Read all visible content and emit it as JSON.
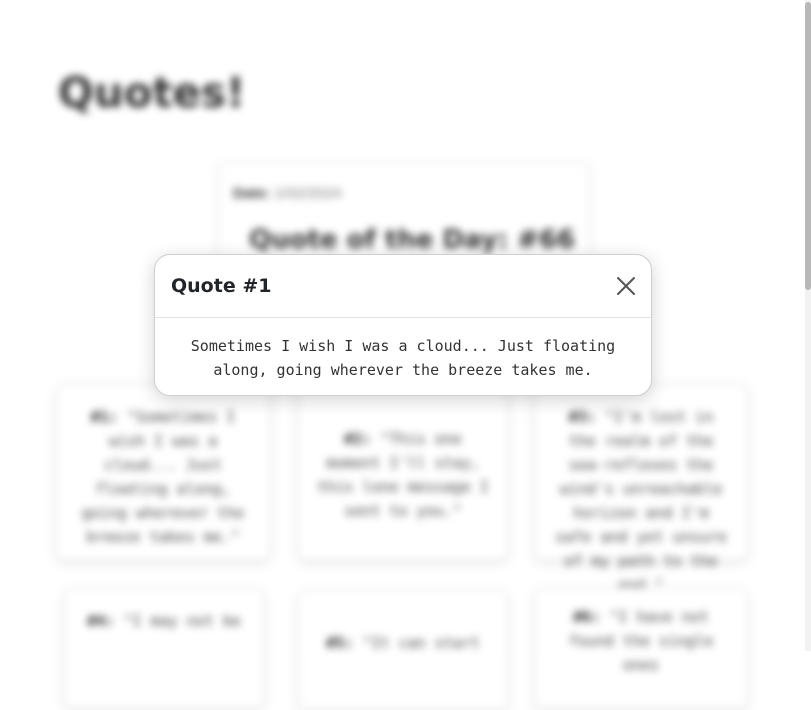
{
  "page": {
    "title": "Quotes!",
    "quote_of_the_day": {
      "date_label": "Date:",
      "date_value": "1/02/2024",
      "title": "Quote of the Day: #66"
    },
    "quote_cards": [
      {
        "number": "#1:",
        "text": "\"Sometimes I wish I was a cloud... Just floating along, going wherever the breeze takes me.\""
      },
      {
        "number": "#2:",
        "text": "\"This one moment I'll stay, this lone message I sent to you.\""
      },
      {
        "number": "#3:",
        "text": "\"I'm lost in the realm of the sea-reflexes the wind's unreachable horizon and I'm safe and yet unsure of my path to the end.\""
      },
      {
        "number": "#4:",
        "text": "\"I may not be"
      },
      {
        "number": "#5:",
        "text": "\"It can start"
      },
      {
        "number": "#6:",
        "text": "\"I have not found the single ones"
      }
    ]
  },
  "modal": {
    "title": "Quote #1",
    "body": "Sometimes I wish I was a cloud... Just floating along, going wherever the breeze takes me.",
    "close_icon": "close-icon"
  }
}
